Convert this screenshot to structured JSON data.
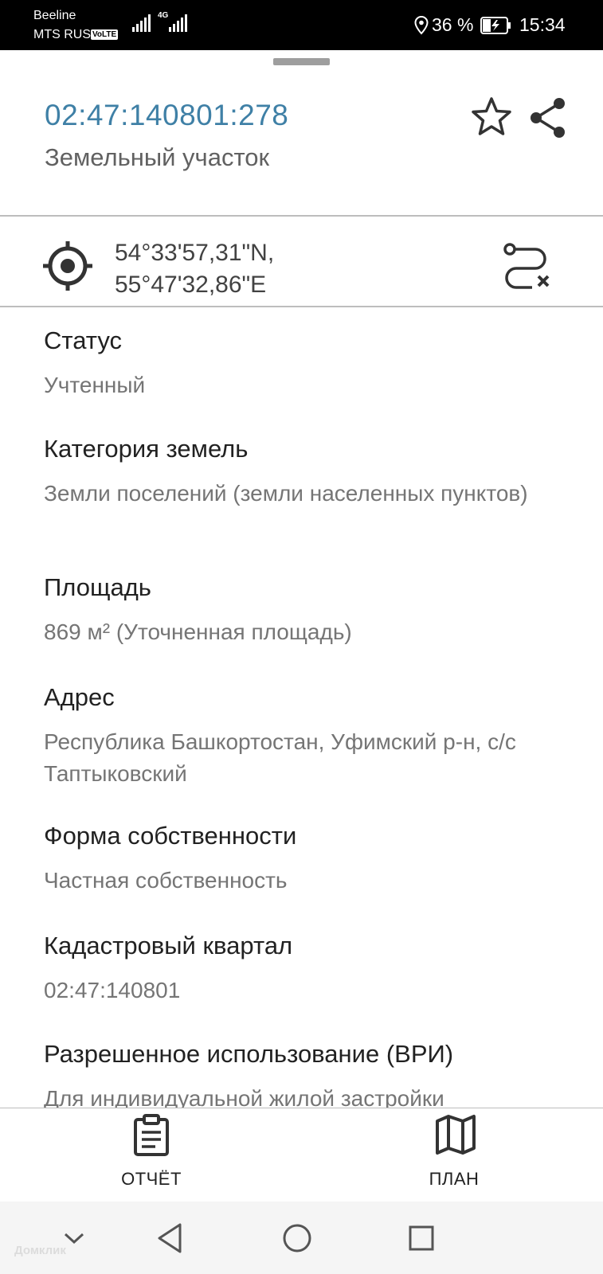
{
  "status_bar": {
    "carrier_1": "Beeline",
    "carrier_2": "MTS RUS",
    "volte_badge": "VoLTE",
    "network_type": "4G",
    "battery_percent": "36 %",
    "time": "15:34"
  },
  "header": {
    "cadastral_number": "02:47:140801:278",
    "object_type": "Земельный участок",
    "favorite_icon": "star-icon",
    "share_icon": "share-icon"
  },
  "location": {
    "latitude": "54°33'57,31\"N,",
    "longitude": "55°47'32,86\"E",
    "locate_icon": "target-icon",
    "route_icon": "route-clear-icon"
  },
  "fields": [
    {
      "label": "Статус",
      "value": "Учтенный"
    },
    {
      "label": "Категория земель",
      "value": "Земли поселений (земли населенных пунктов)"
    },
    {
      "label": "Площадь",
      "value": "869 м² (Уточненная площадь)"
    },
    {
      "label": "Адрес",
      "value": "Республика Башкортостан, Уфимский р-н, с/с Таптыковский"
    },
    {
      "label": "Форма собственности",
      "value": "Частная собственность"
    },
    {
      "label": "Кадастровый квартал",
      "value": "02:47:140801"
    },
    {
      "label": "Разрешенное использование (ВРИ)",
      "value": "Для индивидуальной жилой застройки"
    }
  ],
  "bottom_tabs": {
    "report_label": "ОТЧЁТ",
    "plan_label": "ПЛАН"
  },
  "watermark": "Домклик",
  "colors": {
    "accent": "#3f80a6",
    "label_text": "#212121",
    "value_text": "#757575"
  }
}
